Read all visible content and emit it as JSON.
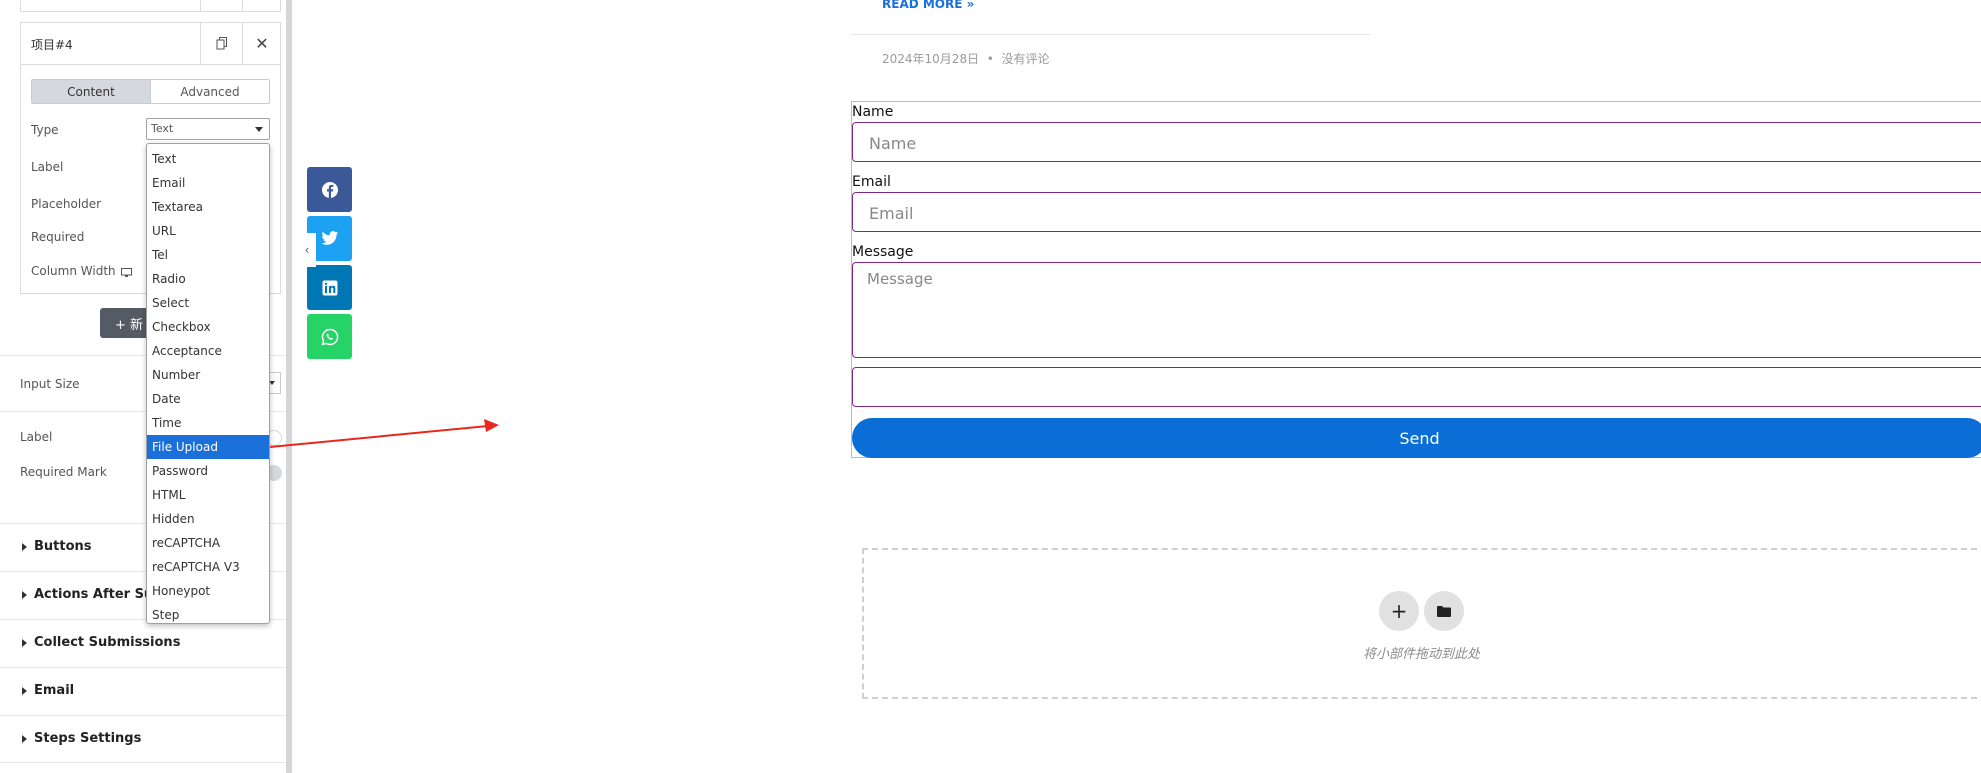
{
  "editor": {
    "item_title": "项目#4",
    "tabs": [
      "Content",
      "Advanced"
    ],
    "fields": {
      "type": "Type",
      "label": "Label",
      "placeholder": "Placeholder",
      "required": "Required",
      "column_width": "Column Width"
    },
    "type_value": "Text",
    "new_item_button": "+ 新",
    "input_size": "Input Size",
    "label_setting": "Label",
    "required_mark": "Required Mark",
    "sections": [
      "Buttons",
      "Actions After Sub",
      "Collect Submissions",
      "Email",
      "Steps Settings"
    ]
  },
  "dropdown": {
    "options": [
      "Text",
      "Email",
      "Textarea",
      "URL",
      "Tel",
      "Radio",
      "Select",
      "Checkbox",
      "Acceptance",
      "Number",
      "Date",
      "Time",
      "File Upload",
      "Password",
      "HTML",
      "Hidden",
      "reCAPTCHA",
      "reCAPTCHA V3",
      "Honeypot",
      "Step"
    ],
    "selected": "File Upload"
  },
  "share": [
    "facebook-icon",
    "twitter-icon",
    "linkedin-icon",
    "whatsapp-icon"
  ],
  "share_colors": {
    "facebook": "#3b5998",
    "twitter": "#1da1f2",
    "linkedin": "#0077b5",
    "whatsapp": "#25d366"
  },
  "post": {
    "read_more": "READ MORE »",
    "date": "2024年10月28日",
    "separator": "•",
    "comments": "没有评论"
  },
  "form": {
    "name_label": "Name",
    "name_placeholder": "Name",
    "email_label": "Email",
    "email_placeholder": "Email",
    "message_label": "Message",
    "message_placeholder": "Message",
    "send_label": "Send",
    "accent": "#0a6ed6"
  },
  "drop_area": {
    "text": "将小部件拖动到此处"
  }
}
